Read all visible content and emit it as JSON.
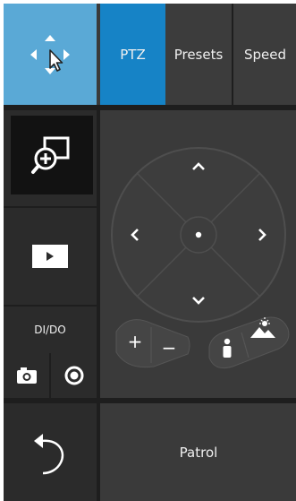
{
  "colors": {
    "accent": "#5aa9d6",
    "tab_active": "#1683c6",
    "panel_bg": "#3a3a3a",
    "tile_bg": "#2b2b2b"
  },
  "tabs": [
    {
      "label": "PTZ",
      "active": true
    },
    {
      "label": "Presets",
      "active": false
    },
    {
      "label": "Speed",
      "active": false
    }
  ],
  "sidebar": {
    "move_icon": "move-cursor-icon",
    "zoom_icon": "digital-zoom-icon",
    "play_icon": "play-icon",
    "dido_label": "DI/DO",
    "snapshot_icon": "camera-icon",
    "record_icon": "record-icon",
    "back_icon": "undo-arrow-icon"
  },
  "ptz": {
    "zoom_in_label": "+",
    "zoom_out_label": "−",
    "focus_near_icon": "person-icon",
    "focus_far_icon": "landscape-icon"
  },
  "footer": {
    "patrol_label": "Patrol"
  }
}
